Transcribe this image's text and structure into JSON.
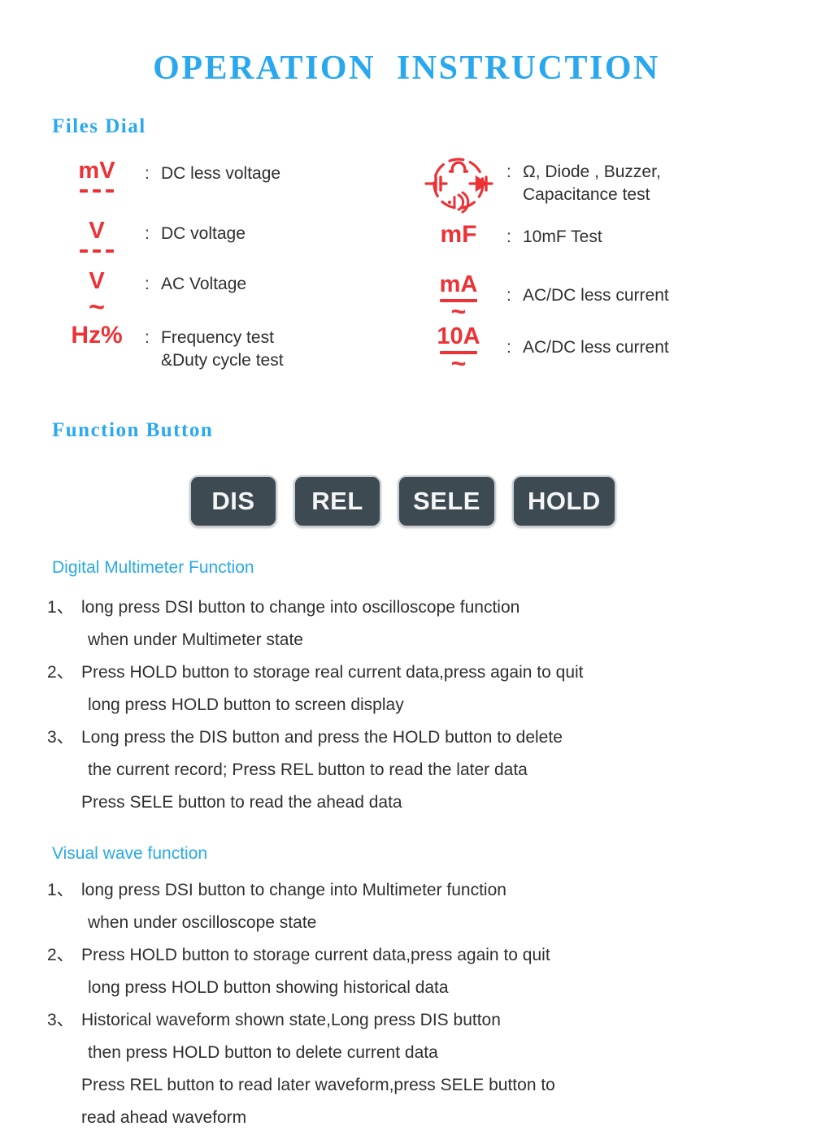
{
  "title": "OPERATION  INSTRUCTION",
  "colors": {
    "heading_blue": "#2aa8ef",
    "sub_heading_blue": "#29a9e8",
    "symbol_red": "#ec3237",
    "button_face": "#3e4a52",
    "button_text": "#f4f6f7",
    "body_text": "#2f2f2f"
  },
  "sections": {
    "files_dial": {
      "heading": "Files  Dial",
      "left_column": [
        {
          "symbol_text": "mV",
          "symbol_mark": "dc",
          "colon": ":",
          "description": "DC less voltage"
        },
        {
          "symbol_text": "V",
          "symbol_mark": "dc",
          "colon": ":",
          "description": "DC voltage"
        },
        {
          "symbol_text": "V",
          "symbol_mark": "ac",
          "colon": ":",
          "description": "AC Voltage"
        },
        {
          "symbol_text": "Hz%",
          "symbol_mark": "none",
          "colon": ":",
          "description": "Frequency test\n&Duty cycle test"
        }
      ],
      "right_column": [
        {
          "symbol_text": "",
          "symbol_mark": "omega-composite-icon",
          "colon": ":",
          "description": "Ω, Diode , Buzzer,\nCapacitance test"
        },
        {
          "symbol_text": "mF",
          "symbol_mark": "none",
          "colon": ":",
          "description": "10mF Test"
        },
        {
          "symbol_text": "mA",
          "symbol_mark": "acdc",
          "colon": ":",
          "description": "AC/DC less current"
        },
        {
          "symbol_text": "10A",
          "symbol_mark": "acdc",
          "colon": ":",
          "description": "AC/DC less current"
        }
      ]
    },
    "function_button": {
      "heading": "Function  Button",
      "buttons": [
        {
          "label": "DIS"
        },
        {
          "label": "REL"
        },
        {
          "label": "SELE"
        },
        {
          "label": "HOLD"
        }
      ]
    },
    "digital_multimeter_function": {
      "heading": "Digital Multimeter Function",
      "items": [
        {
          "number": "1、",
          "lines": [
            "long press DSI button to change into oscilloscope function",
            "when under Multimeter state"
          ]
        },
        {
          "number": "2、",
          "lines": [
            "Press HOLD button to storage real current data,press again to quit",
            "long press HOLD button to screen display"
          ]
        },
        {
          "number": "3、",
          "lines": [
            "Long press the DIS button and press the HOLD button to delete",
            "the current record; Press REL button to read the later data",
            "Press SELE button to read the ahead data"
          ]
        }
      ]
    },
    "visual_wave_function": {
      "heading": "Visual wave function",
      "items": [
        {
          "number": "1、",
          "lines": [
            "long press DSI button to change into Multimeter function",
            "when under oscilloscope state"
          ]
        },
        {
          "number": "2、",
          "lines": [
            "Press HOLD button to storage current data,press again to quit",
            "long press HOLD button showing historical data"
          ]
        },
        {
          "number": "3、",
          "lines": [
            "Historical waveform shown state,Long press DIS button",
            "then press HOLD button to delete current data",
            "Press REL button to read later waveform,press SELE button to",
            "read ahead waveform"
          ]
        }
      ]
    }
  }
}
